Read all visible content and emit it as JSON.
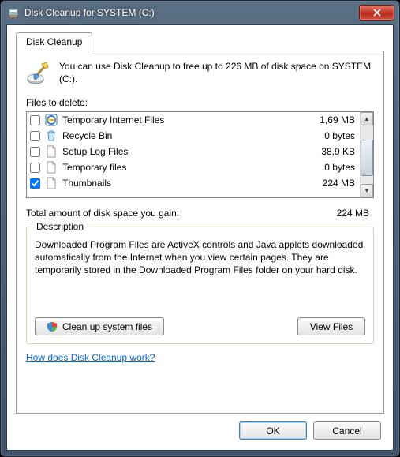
{
  "window": {
    "title": "Disk Cleanup for SYSTEM (C:)"
  },
  "tab": {
    "label": "Disk Cleanup"
  },
  "intro": {
    "text": "You can use Disk Cleanup to free up to 226 MB of disk space on SYSTEM (C:)."
  },
  "files_label": "Files to delete:",
  "files": [
    {
      "name": "Temporary Internet Files",
      "size": "1,69 MB",
      "checked": false,
      "icon": "ie"
    },
    {
      "name": "Recycle Bin",
      "size": "0 bytes",
      "checked": false,
      "icon": "bin"
    },
    {
      "name": "Setup Log Files",
      "size": "38,9 KB",
      "checked": false,
      "icon": "file"
    },
    {
      "name": "Temporary files",
      "size": "0 bytes",
      "checked": false,
      "icon": "file"
    },
    {
      "name": "Thumbnails",
      "size": "224 MB",
      "checked": true,
      "icon": "file"
    }
  ],
  "total": {
    "label": "Total amount of disk space you gain:",
    "value": "224 MB"
  },
  "description": {
    "legend": "Description",
    "text": "Downloaded Program Files are ActiveX controls and Java applets downloaded automatically from the Internet when you view certain pages. They are temporarily stored in the Downloaded Program Files folder on your hard disk."
  },
  "buttons": {
    "clean_system": "Clean up system files",
    "view_files": "View Files",
    "ok": "OK",
    "cancel": "Cancel"
  },
  "help_link": "How does Disk Cleanup work?"
}
